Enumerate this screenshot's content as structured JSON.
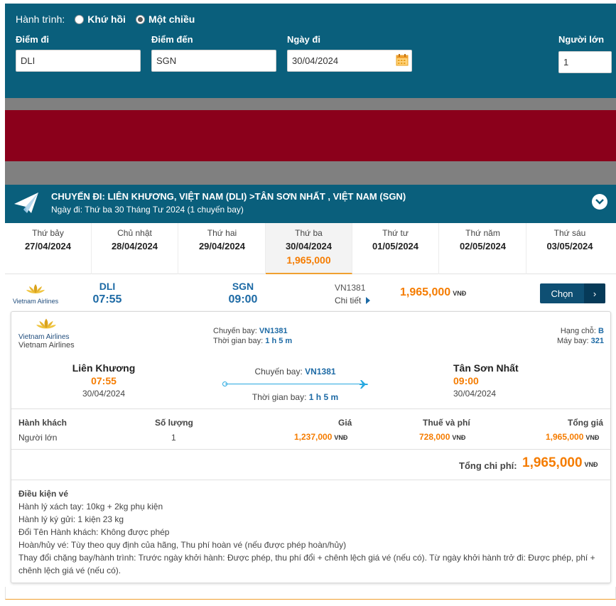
{
  "search": {
    "trip_label": "Hành trình:",
    "trip_options": [
      {
        "label": "Khứ hồi",
        "selected": false
      },
      {
        "label": "Một chiều",
        "selected": true
      }
    ],
    "origin_label": "Điểm đi",
    "origin_value": "DLI",
    "destination_label": "Điểm đến",
    "destination_value": "SGN",
    "date_label": "Ngày đi",
    "date_value": "30/04/2024",
    "adults_label": "Người lớn",
    "adults_value": "1"
  },
  "route": {
    "title": "CHUYẾN ĐI: LIÊN KHƯƠNG, VIỆT NAM (DLI) >TÂN SƠN NHẤT , VIỆT NAM (SGN)",
    "subtitle": "Ngày đi: Thứ ba 30 Tháng Tư 2024 (1 chuyến bay)"
  },
  "date_tabs": [
    {
      "day": "Thứ bảy",
      "date": "27/04/2024",
      "price": "",
      "active": false
    },
    {
      "day": "Chủ nhật",
      "date": "28/04/2024",
      "price": "",
      "active": false
    },
    {
      "day": "Thứ hai",
      "date": "29/04/2024",
      "price": "",
      "active": false
    },
    {
      "day": "Thứ ba",
      "date": "30/04/2024",
      "price": "1,965,000",
      "active": true
    },
    {
      "day": "Thứ tư",
      "date": "01/05/2024",
      "price": "",
      "active": false
    },
    {
      "day": "Thứ năm",
      "date": "02/05/2024",
      "price": "",
      "active": false
    },
    {
      "day": "Thứ sáu",
      "date": "03/05/2024",
      "price": "",
      "active": false
    }
  ],
  "flight": {
    "airline_logo_text": "Vietnam Airlines",
    "airline_name": "Vietnam Airlines",
    "from_code": "DLI",
    "from_time": "07:55",
    "to_code": "SGN",
    "to_time": "09:00",
    "flight_no": "VN1381",
    "detail_label": "Chi tiết",
    "price": "1,965,000",
    "currency": "VNĐ",
    "choose_label": "Chọn"
  },
  "detail": {
    "flight_label": "Chuyến bay:",
    "flight_no": "VN1381",
    "duration_label": "Thời gian bay:",
    "duration": "1 h 5 m",
    "class_label": "Hạng chỗ:",
    "class_value": "B",
    "aircraft_label": "Máy bay:",
    "aircraft_value": "321",
    "from_city": "Liên Khương",
    "from_time": "07:55",
    "from_date": "30/04/2024",
    "to_city": "Tân Sơn Nhất",
    "to_time": "09:00",
    "to_date": "30/04/2024"
  },
  "pricing": {
    "headers": {
      "passenger": "Hành khách",
      "qty": "Số lượng",
      "price": "Giá",
      "tax": "Thuế và phí",
      "total": "Tổng giá"
    },
    "row": {
      "passenger": "Người lớn",
      "qty": "1",
      "price": "1,237,000",
      "tax": "728,000",
      "total": "1,965,000"
    },
    "currency": "VNĐ",
    "grand_total_label": "Tổng chi phí:",
    "grand_total": "1,965,000"
  },
  "conditions": {
    "title": "Điều kiện vé",
    "lines": [
      "Hành lý xách tay: 10kg + 2kg phụ kiện",
      "Hành lý ký gửi: 1 kiện 23 kg",
      "Đổi Tên Hành khách: Không được phép",
      "Hoàn/hủy vé: Tùy theo quy định của hãng, Thu phí hoàn vé (nếu được phép hoàn/hủy)",
      "Thay đổi chặng bay/hành trình: Trước ngày khởi hành: Được phép, thu phí đổi + chênh lệch giá vé (nếu có). Từ ngày khởi hành trở đi: Được phép, phí + chênh lệch giá vé (nếu có)."
    ]
  },
  "colors": {
    "header_bg": "#0a5f7c",
    "banner_red": "#8b001b",
    "price_orange": "#f57c00",
    "link_blue": "#1d6aa5"
  }
}
